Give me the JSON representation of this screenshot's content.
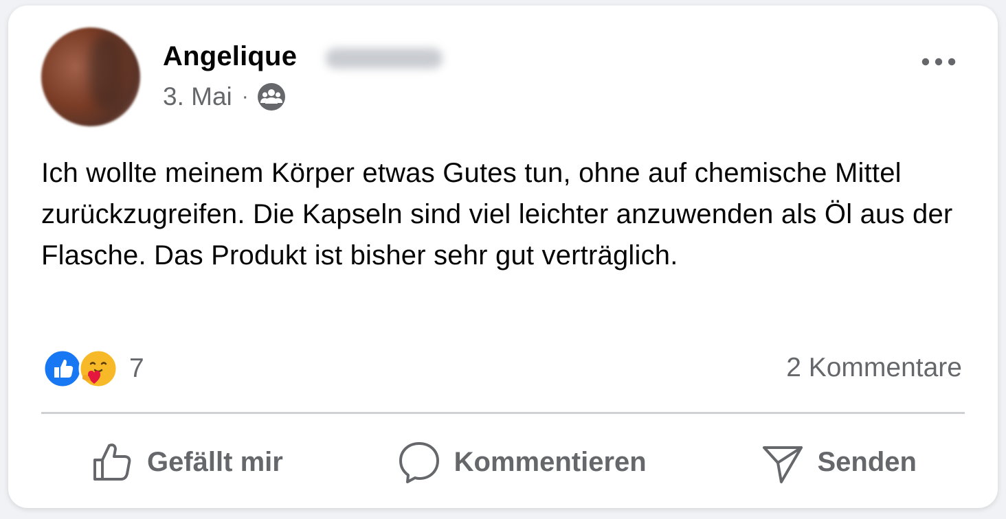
{
  "post": {
    "author_first_name": "Angelique",
    "date": "3. Mai",
    "separator": "·",
    "audience_icon": "group-icon",
    "menu_icon": "more-horizontal-icon",
    "text": "Ich wollte meinem Körper etwas Gutes tun, ohne auf chemische Mittel zurückzugreifen. Die Kapseln sind viel leichter anzuwenden als Öl aus der Flasche. Das Produkt ist bisher sehr gut verträglich."
  },
  "reactions": {
    "icons": [
      "like-reaction-icon",
      "care-reaction-icon"
    ],
    "count": "7",
    "comments_label": "2 Kommentare"
  },
  "actions": {
    "like_label": "Gefällt mir",
    "comment_label": "Kommentieren",
    "send_label": "Senden"
  },
  "colors": {
    "card_background": "#ffffff",
    "page_background": "#f0f2f5",
    "text_primary": "#050505",
    "text_secondary": "#65676b",
    "like_blue": "#1877f2",
    "care_yellow": "#f7b928",
    "heart_red": "#e4173e"
  }
}
